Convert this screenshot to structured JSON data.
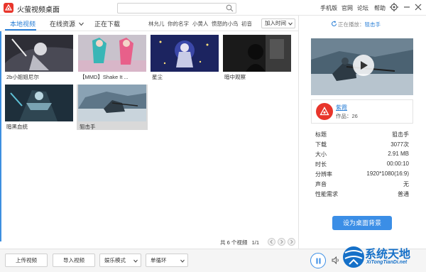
{
  "app": {
    "title": "火萤视频桌面"
  },
  "search": {
    "value": "",
    "placeholder": ""
  },
  "header_links": {
    "mobile": "手机版",
    "official": "官网",
    "forum": "论坛",
    "help": "帮助"
  },
  "tabs": [
    {
      "label": "本地视频",
      "active": true
    },
    {
      "label": "在线资源",
      "active": false
    },
    {
      "label": "正在下载",
      "active": false
    }
  ],
  "tags": [
    "林允儿",
    "你的名字",
    "小黄人",
    "愤怒的小鸟",
    "初音"
  ],
  "sort": {
    "selected": "加入时间"
  },
  "videos": [
    {
      "title": "2b小姐姐尼尔",
      "selected": false
    },
    {
      "title": "【MMD】Shake It ...",
      "selected": false
    },
    {
      "title": "星尘",
      "selected": false
    },
    {
      "title": "暗中观察",
      "selected": false
    },
    {
      "title": "暗黑血统",
      "selected": false
    },
    {
      "title": "狙击手",
      "selected": true
    }
  ],
  "pagination": {
    "total_text": "共 6 个视频",
    "page_text": "1/1"
  },
  "now_playing": {
    "prefix": "正在播放：",
    "title": "狙击手"
  },
  "author": {
    "name": "紫霞",
    "works": "作品：26"
  },
  "details": [
    {
      "key": "标题",
      "value": "狙击手"
    },
    {
      "key": "下载",
      "value": "3077次"
    },
    {
      "key": "大小",
      "value": "2.91 MB"
    },
    {
      "key": "时长",
      "value": "00:00:10"
    },
    {
      "key": "分辨率",
      "value": "1920*1080(16:9)"
    },
    {
      "key": "声音",
      "value": "无"
    },
    {
      "key": "性能需求",
      "value": "普通"
    }
  ],
  "actions": {
    "set_wallpaper": "设为桌面背景"
  },
  "bottom": {
    "upload": "上传视频",
    "import": "导入视频",
    "mode": "娱乐模式",
    "loop": "单循环"
  },
  "watermark": {
    "title": "系统天地",
    "url": "XiTongTianDi.net"
  },
  "colors": {
    "accent": "#2a7fd6",
    "button": "#3b8ee6",
    "logo": "#e8352b"
  }
}
